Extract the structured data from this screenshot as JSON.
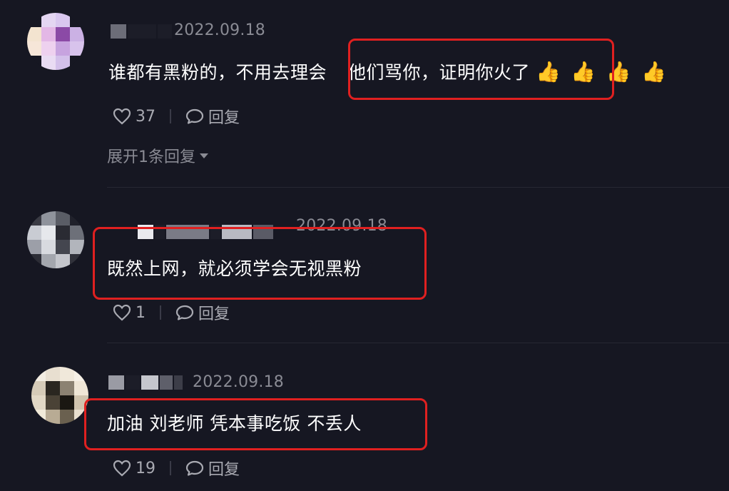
{
  "comments": [
    {
      "date": "2022.09.18",
      "text_plain": "谁都有黑粉的，不用去理会",
      "text_highlight": "他们骂你，证明你火了",
      "emojis": [
        "👍",
        "👍",
        "👍",
        "👍"
      ],
      "likes": "37",
      "reply_label": "回复",
      "expand_label": "展开1条回复"
    },
    {
      "date": "2022.09.18",
      "text_highlight": "既然上网，就必须学会无视黑粉",
      "likes": "1",
      "reply_label": "回复"
    },
    {
      "date": "2022.09.18",
      "text_highlight": "加油 刘老师 凭本事吃饭 不丢人",
      "likes": "19",
      "reply_label": "回复"
    }
  ],
  "colors": {
    "background": "#161722",
    "highlight_box": "#e02020",
    "secondary_text": "#8a8b94"
  },
  "icons": [
    "heart-icon",
    "comment-bubble-icon",
    "caret-down-icon",
    "thumbs-up-emoji"
  ]
}
